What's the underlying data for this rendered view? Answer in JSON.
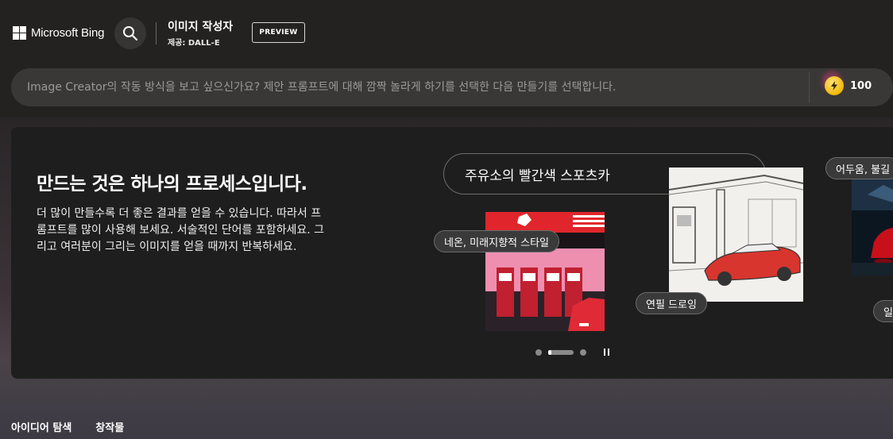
{
  "header": {
    "logo_text": "Microsoft Bing",
    "app_title": "이미지 작성자",
    "app_subtitle": "제공: DALL-E",
    "preview_label": "PREVIEW"
  },
  "prompt": {
    "placeholder": "Image Creator의 작동 방식을 보고 싶으신가요? 제안 프롬프트에 대해 깜짝 놀라게 하기를 선택한 다음 만들기를 선택합니다.",
    "value": "",
    "boosts": "100"
  },
  "hero": {
    "title": "만드는 것은 하나의 프로세스입니다.",
    "description": "더 많이 만들수록 더 좋은 결과를 얻을 수 있습니다. 따라서 프롬프트를 많이 사용해 보세요. 서술적인 단어를 포함하세요. 그리고 여러분이 그리는 이미지를 얻을 때까지 반복하세요.",
    "example_prompt": "주유소의 빨간색 스포츠카",
    "tags": {
      "neon": "네온, 미래지향적 스타일",
      "pencil": "연필 드로잉",
      "dark": "어두움, 불길",
      "extra": "일"
    },
    "carousel": {
      "total_dots": 3,
      "active_dot": 2
    }
  },
  "tabs": [
    "아이디어 탐색",
    "창작물"
  ],
  "colors": {
    "coin": "#f2b705",
    "accent_red": "#e0262c",
    "neon_teal": "#7fe3d6"
  }
}
